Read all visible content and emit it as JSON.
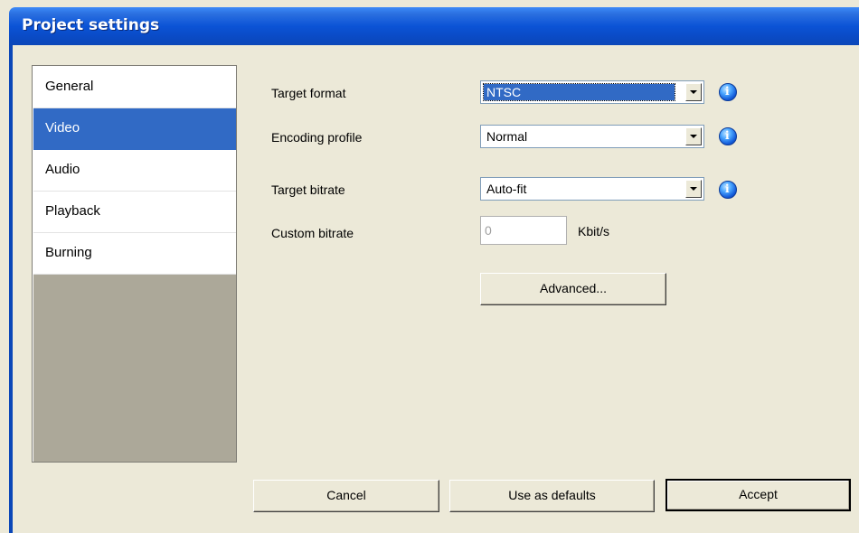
{
  "window": {
    "title": "Project settings"
  },
  "sidebar": {
    "items": [
      {
        "label": "General",
        "selected": false
      },
      {
        "label": "Video",
        "selected": true
      },
      {
        "label": "Audio",
        "selected": false
      },
      {
        "label": "Playback",
        "selected": false
      },
      {
        "label": "Burning",
        "selected": false
      }
    ]
  },
  "form": {
    "target_format": {
      "label": "Target format",
      "value": "NTSC"
    },
    "encoding_profile": {
      "label": "Encoding profile",
      "value": "Normal"
    },
    "target_bitrate": {
      "label": "Target bitrate",
      "value": "Auto-fit"
    },
    "custom_bitrate": {
      "label": "Custom bitrate",
      "value": "0",
      "unit": "Kbit/s"
    },
    "advanced_label": "Advanced..."
  },
  "footer": {
    "cancel_label": "Cancel",
    "defaults_label": "Use as defaults",
    "accept_label": "Accept"
  },
  "icons": {
    "info": "info-icon",
    "dropdown": "chevron-down-icon"
  },
  "colors": {
    "titlebar": "#0b53d6",
    "selection": "#316ac5",
    "face": "#ece9d8"
  }
}
